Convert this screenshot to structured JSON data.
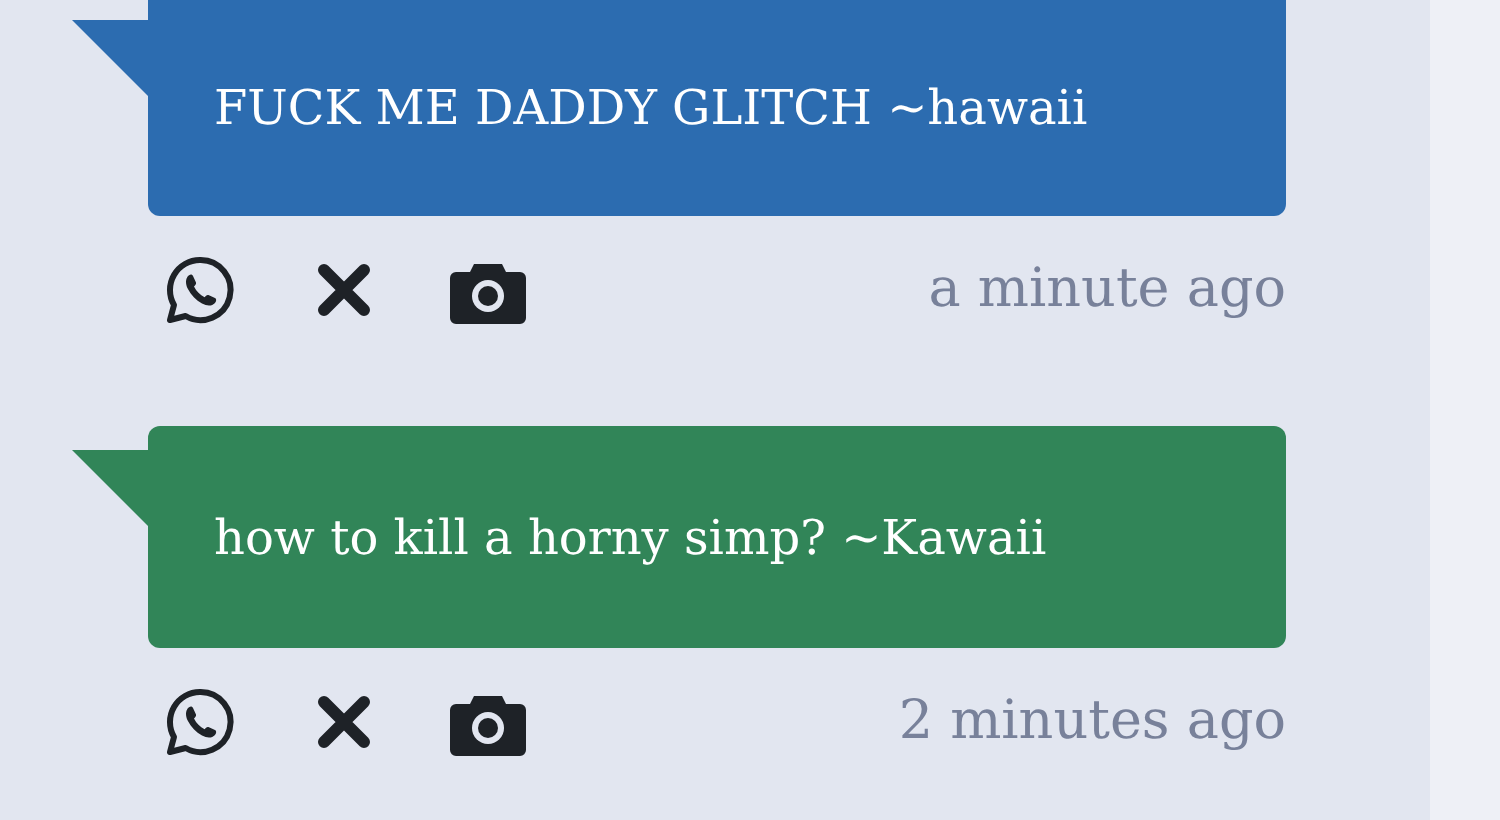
{
  "messages": [
    {
      "text": "FUCK ME DADDY GLITCH ~hawaii",
      "color": "#2c6cb0",
      "time": "a minute ago"
    },
    {
      "text": "how to kill a horny simp? ~Kawaii",
      "color": "#318558",
      "time": "2 minutes ago"
    }
  ]
}
